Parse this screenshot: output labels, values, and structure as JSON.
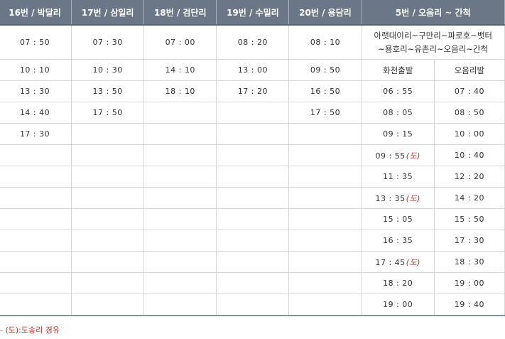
{
  "headers": [
    "16번 / 박달리",
    "17번 / 삼일리",
    "18번 / 검단리",
    "19번 / 수밀리",
    "20번 / 용담리",
    "5번 / 오음리 ~ 간척"
  ],
  "route_desc_line1": "아랫대이리~구만리~파로호~뱃터",
  "route_desc_line2": "~용호리~유촌리~오음리~간척",
  "subheaders": [
    "화천출발",
    "오음리발"
  ],
  "first_times": [
    "07 : 50",
    "07 : 30",
    "07 : 00",
    "08 : 20",
    "08 : 10"
  ],
  "rows": [
    {
      "c": [
        "10 : 10",
        "10 : 30",
        "14 : 10",
        "13 : 00",
        "09 : 50"
      ],
      "s1": "",
      "s2": ""
    },
    {
      "c": [
        "13 : 30",
        "13 : 50",
        "18 : 10",
        "17 : 20",
        "16 : 50"
      ],
      "s1": "06 : 55",
      "s2": "07 : 40"
    },
    {
      "c": [
        "14 : 40",
        "17 : 50",
        "",
        "",
        "17 : 50"
      ],
      "s1": "08 : 05",
      "s2": "08 : 50"
    },
    {
      "c": [
        "17 : 30",
        "",
        "",
        "",
        "",
        ""
      ],
      "s1": "09 : 15",
      "s2": "10 : 00"
    },
    {
      "c": [
        "",
        "",
        "",
        "",
        ""
      ],
      "s1": "09 : 55",
      "n1": "(도)",
      "s2": "10 : 40"
    },
    {
      "c": [
        "",
        "",
        "",
        "",
        ""
      ],
      "s1": "11 : 35",
      "s2": "12 : 20"
    },
    {
      "c": [
        "",
        "",
        "",
        "",
        ""
      ],
      "s1": "13 : 35",
      "n1": "(도)",
      "s2": "14 : 20"
    },
    {
      "c": [
        "",
        "",
        "",
        "",
        ""
      ],
      "s1": "15 : 05",
      "s2": "15 : 50"
    },
    {
      "c": [
        "",
        "",
        "",
        "",
        ""
      ],
      "s1": "16 : 35",
      "s2": "17 : 30"
    },
    {
      "c": [
        "",
        "",
        "",
        "",
        ""
      ],
      "s1": "17 : 45",
      "n1": "(도)",
      "s2": "18 : 30"
    },
    {
      "c": [
        "",
        "",
        "",
        "",
        ""
      ],
      "s1": "18 : 20",
      "s2": "19 : 00"
    },
    {
      "c": [
        "",
        "",
        "",
        "",
        ""
      ],
      "s1": "19 : 00",
      "s2": "19 : 40"
    }
  ],
  "legend": "- (도):도송리 경유"
}
